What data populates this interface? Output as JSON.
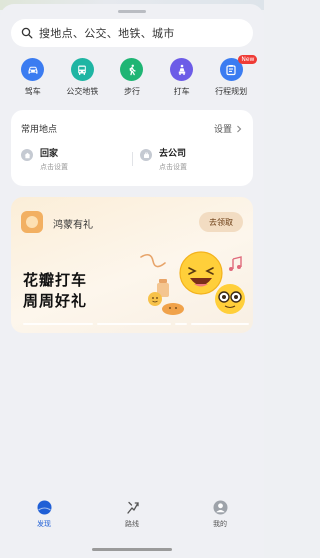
{
  "search": {
    "placeholder": "搜地点、公交、地铁、城市"
  },
  "quick_actions": [
    {
      "label": "驾车",
      "icon": "car-icon",
      "color": "#3b7cf1"
    },
    {
      "label": "公交地铁",
      "icon": "bus-icon",
      "color": "#1fb5a3"
    },
    {
      "label": "步行",
      "icon": "walk-icon",
      "color": "#1fb574"
    },
    {
      "label": "打车",
      "icon": "taxi-icon",
      "color": "#6c5ce7"
    },
    {
      "label": "行程规划",
      "icon": "route-plan-icon",
      "color": "#3b7cf1",
      "badge": "New"
    }
  ],
  "favorites": {
    "title": "常用地点",
    "settings": "设置",
    "places": [
      {
        "name": "回家",
        "hint": "点击设置",
        "icon": "home-icon"
      },
      {
        "name": "去公司",
        "hint": "点击设置",
        "icon": "office-icon"
      }
    ]
  },
  "promo": {
    "brand": "鸿蒙有礼",
    "button": "去领取",
    "headline1": "花瓣打车",
    "headline2": "周周好礼"
  },
  "tabs": [
    {
      "label": "发现",
      "icon": "discover-icon",
      "active": true
    },
    {
      "label": "路线",
      "icon": "route-icon",
      "active": false
    },
    {
      "label": "我的",
      "icon": "profile-icon",
      "active": false
    }
  ],
  "colors": {
    "accent": "#1f5fd6",
    "promo_button_bg": "#f2dcc2"
  }
}
